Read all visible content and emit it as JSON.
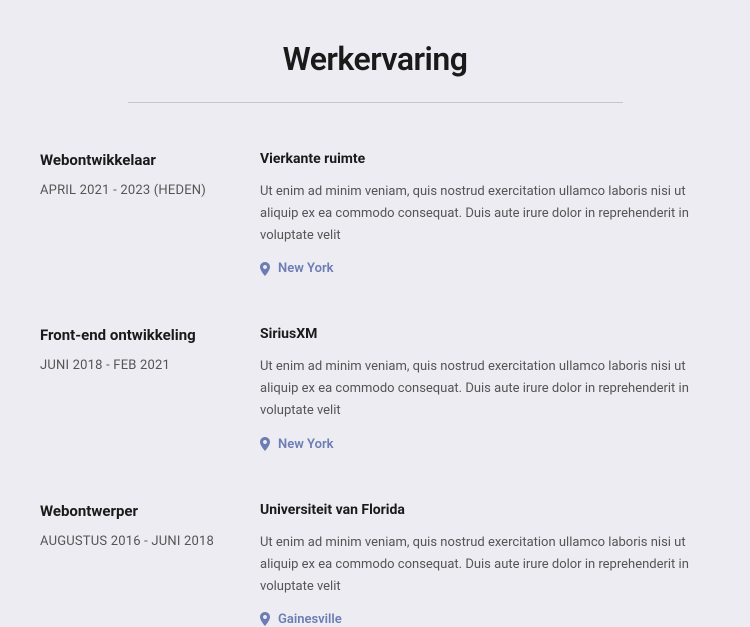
{
  "title": "Werkervaring",
  "entries": [
    {
      "role": "Webontwikkelaar",
      "dates": "APRIL 2021 - 2023 (HEDEN)",
      "company": "Vierkante ruimte",
      "description": "Ut enim ad minim veniam, quis nostrud exercitation ullamco laboris nisi ut aliquip ex ea commodo consequat. Duis aute irure dolor in reprehenderit in voluptate velit",
      "location": "New York"
    },
    {
      "role": "Front-end ontwikkeling",
      "dates": "JUNI 2018 - FEB 2021",
      "company": "SiriusXM",
      "description": "Ut enim ad minim veniam, quis nostrud exercitation ullamco laboris nisi ut aliquip ex ea commodo consequat. Duis aute irure dolor in reprehenderit in voluptate velit",
      "location": "New York"
    },
    {
      "role": "Webontwerper",
      "dates": "AUGUSTUS 2016 - JUNI 2018",
      "company": "Universiteit van Florida",
      "description": "Ut enim ad minim veniam, quis nostrud exercitation ullamco laboris nisi ut aliquip ex ea commodo consequat. Duis aute irure dolor in reprehenderit in voluptate velit",
      "location": "Gainesville"
    }
  ]
}
